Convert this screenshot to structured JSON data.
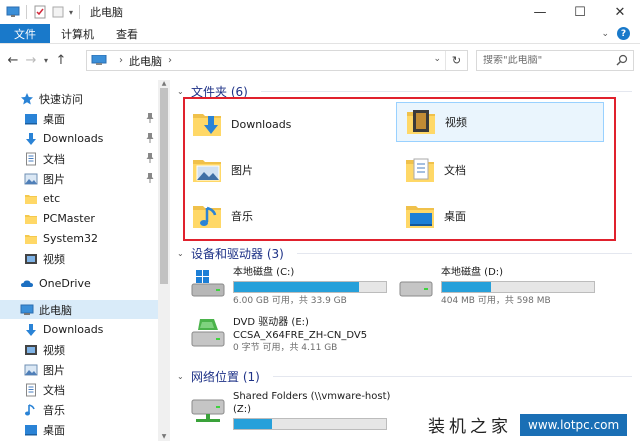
{
  "window": {
    "title": "此电脑",
    "min": "—",
    "max": "☐",
    "close": "✕"
  },
  "ribbon": {
    "tabs": [
      "文件",
      "计算机",
      "查看"
    ],
    "expand": "⌄",
    "help": "?"
  },
  "address": {
    "crumbs": [
      "此电脑"
    ],
    "search_placeholder": "搜索\"此电脑\""
  },
  "nav": {
    "items": [
      {
        "label": "快速访问",
        "icon": "star-icon",
        "pinned": false
      },
      {
        "label": "桌面",
        "icon": "desktop-icon",
        "pinned": true
      },
      {
        "label": "Downloads",
        "icon": "download-arrow-icon",
        "pinned": true
      },
      {
        "label": "文档",
        "icon": "document-icon",
        "pinned": true
      },
      {
        "label": "图片",
        "icon": "pictures-icon",
        "pinned": true
      },
      {
        "label": "etc",
        "icon": "folder-icon",
        "pinned": false
      },
      {
        "label": "PCMaster",
        "icon": "folder-icon",
        "pinned": false
      },
      {
        "label": "System32",
        "icon": "folder-icon",
        "pinned": false
      },
      {
        "label": "视频",
        "icon": "video-icon",
        "pinned": false
      },
      {
        "label": "OneDrive",
        "icon": "cloud-icon",
        "pinned": false
      },
      {
        "label": "此电脑",
        "icon": "computer-icon",
        "pinned": false
      },
      {
        "label": "Downloads",
        "icon": "download-arrow-icon",
        "pinned": false
      },
      {
        "label": "视频",
        "icon": "video-icon",
        "pinned": false
      },
      {
        "label": "图片",
        "icon": "pictures-icon",
        "pinned": false
      },
      {
        "label": "文档",
        "icon": "document-icon",
        "pinned": false
      },
      {
        "label": "音乐",
        "icon": "music-icon",
        "pinned": false
      },
      {
        "label": "桌面",
        "icon": "desktop-icon",
        "pinned": false
      }
    ]
  },
  "groups": {
    "folders": "文件夹 (6)",
    "devices": "设备和驱动器 (3)",
    "network": "网络位置 (1)"
  },
  "folders": [
    {
      "label": "Downloads",
      "icon": "downloads-folder-icon"
    },
    {
      "label": "视频",
      "icon": "videos-folder-icon"
    },
    {
      "label": "图片",
      "icon": "pictures-folder-icon"
    },
    {
      "label": "文档",
      "icon": "documents-folder-icon"
    },
    {
      "label": "音乐",
      "icon": "music-folder-icon"
    },
    {
      "label": "桌面",
      "icon": "desktop-folder-icon"
    }
  ],
  "drives": [
    {
      "name": "本地磁盘 (C:)",
      "size": "6.00 GB 可用，共 33.9 GB",
      "used_fraction": 0.82,
      "icon": "windows-drive-icon"
    },
    {
      "name": "本地磁盘 (D:)",
      "size": "404 MB 可用，共 598 MB",
      "used_fraction": 0.32,
      "icon": "hard-drive-icon"
    },
    {
      "name": "DVD 驱动器 (E:)",
      "name2": "CCSA_X64FRE_ZH-CN_DV5",
      "size": "0 字节 可用，共 4.11 GB",
      "icon": "dvd-drive-icon"
    }
  ],
  "network": [
    {
      "name": "Shared Folders (\\\\vmware-host)",
      "name2": "(Z:)",
      "used_fraction": 0.25,
      "icon": "network-drive-icon"
    }
  ],
  "watermark": {
    "cn": "装机之家",
    "url": "www.lotpc.com"
  },
  "colors": {
    "accent": "#1979ca",
    "highlight_box": "#e0212d",
    "bar_fill": "#26a0da",
    "selected": "#d9ebf9",
    "group_header": "#1e3287"
  }
}
